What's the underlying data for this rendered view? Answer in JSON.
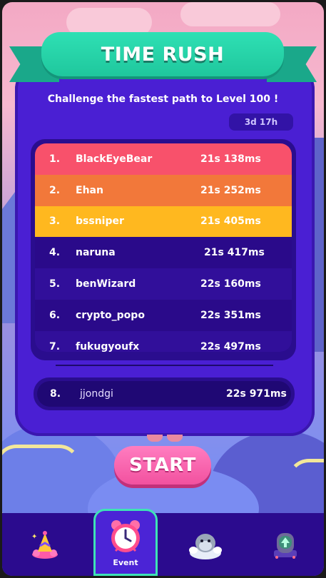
{
  "header": {
    "title": "TIME RUSH",
    "subtitle": "Challenge the fastest path to Level 100 !",
    "time_remaining": "3d 17h"
  },
  "leaderboard": [
    {
      "rank": "1.",
      "name": "BlackEyeBear",
      "time": "21s 138ms"
    },
    {
      "rank": "2.",
      "name": "Ehan",
      "time": "21s 252ms"
    },
    {
      "rank": "3.",
      "name": "bssniper",
      "time": "21s 405ms"
    },
    {
      "rank": "4.",
      "name": "naruna",
      "time": "21s 417ms"
    },
    {
      "rank": "5.",
      "name": "benWizard",
      "time": "22s 160ms"
    },
    {
      "rank": "6.",
      "name": "crypto_popo",
      "time": "22s 351ms"
    },
    {
      "rank": "7.",
      "name": "fukugyoufx",
      "time": "22s 497ms"
    }
  ],
  "player_entry": {
    "rank": "8.",
    "name": "jjondgi",
    "time": "22s 971ms"
  },
  "start_label": "START",
  "nav": {
    "items": [
      {
        "icon": "party-hat-icon",
        "label": ""
      },
      {
        "icon": "alarm-clock-icon",
        "label": "Event"
      },
      {
        "icon": "seal-mascot-icon",
        "label": ""
      },
      {
        "icon": "upgrade-machine-icon",
        "label": ""
      }
    ]
  },
  "colors": {
    "board": "#4a1fd3",
    "ribbon": "#1fc79d",
    "rank1": "#f8516b",
    "rank2": "#f2783a",
    "rank3": "#ffb81f",
    "start": "#f2519f",
    "nav_active_border": "#3ee3b6"
  }
}
